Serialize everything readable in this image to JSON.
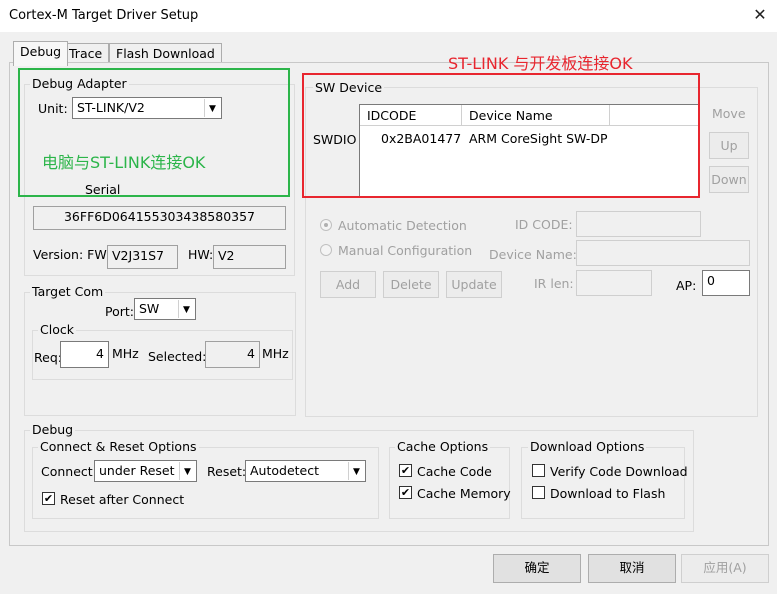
{
  "window": {
    "title": "Cortex-M Target Driver Setup",
    "close_icon": "close-icon"
  },
  "tabs": [
    {
      "label": "Debug"
    },
    {
      "label": "Trace"
    },
    {
      "label": "Flash Download"
    }
  ],
  "annotations": {
    "green_text": "电脑与ST-LINK连接OK",
    "red_text": "ST-LINK 与开发板连接OK",
    "green_color": "#2cb54a",
    "red_color": "#e8262f"
  },
  "debug_adapter": {
    "label": "Debug Adapter",
    "unit_label": "Unit:",
    "unit_value": "ST-LINK/V2",
    "serial_label": "Serial",
    "serial_value": "36FF6D064155303438580357",
    "version_label": "Version: FW:",
    "fw_value": "V2J31S7",
    "hw_label": "HW:",
    "hw_value": "V2"
  },
  "target_com": {
    "label": "Target Com",
    "port_label": "Port:",
    "port_value": "SW",
    "clock_label": "Clock",
    "req_label": "Req:",
    "req_value": "4",
    "req_unit": "MHz",
    "selected_label": "Selected:",
    "selected_value": "4",
    "selected_unit": "MHz"
  },
  "sw_device": {
    "label": "SW Device",
    "side_label": "SWDIO",
    "columns": [
      "IDCODE",
      "Device Name"
    ],
    "rows": [
      {
        "idcode": "0x2BA01477",
        "device": "ARM CoreSight SW-DP"
      }
    ],
    "move_label": "Move",
    "up_label": "Up",
    "down_label": "Down",
    "auto_detect_label": "Automatic Detection",
    "manual_config_label": "Manual Configuration",
    "id_code_label": "ID CODE:",
    "device_name_label": "Device Name:",
    "ir_len_label": "IR len:",
    "ap_label": "AP:",
    "ap_value": "0",
    "add_label": "Add",
    "delete_label": "Delete",
    "update_label": "Update"
  },
  "debug": {
    "label": "Debug",
    "connect_reset_label": "Connect & Reset Options",
    "connect_label": "Connect:",
    "connect_value": "under Reset",
    "reset_label": "Reset:",
    "reset_value": "Autodetect",
    "reset_after_connect_label": "Reset after Connect",
    "reset_after_connect_checked": true,
    "cache_label": "Cache Options",
    "cache_code_label": "Cache Code",
    "cache_code_checked": true,
    "cache_memory_label": "Cache Memory",
    "cache_memory_checked": true,
    "download_label": "Download Options",
    "verify_label": "Verify Code Download",
    "verify_checked": false,
    "download_flash_label": "Download to Flash",
    "download_flash_checked": false
  },
  "footer": {
    "ok_label": "确定",
    "cancel_label": "取消",
    "apply_label": "应用(A)"
  }
}
